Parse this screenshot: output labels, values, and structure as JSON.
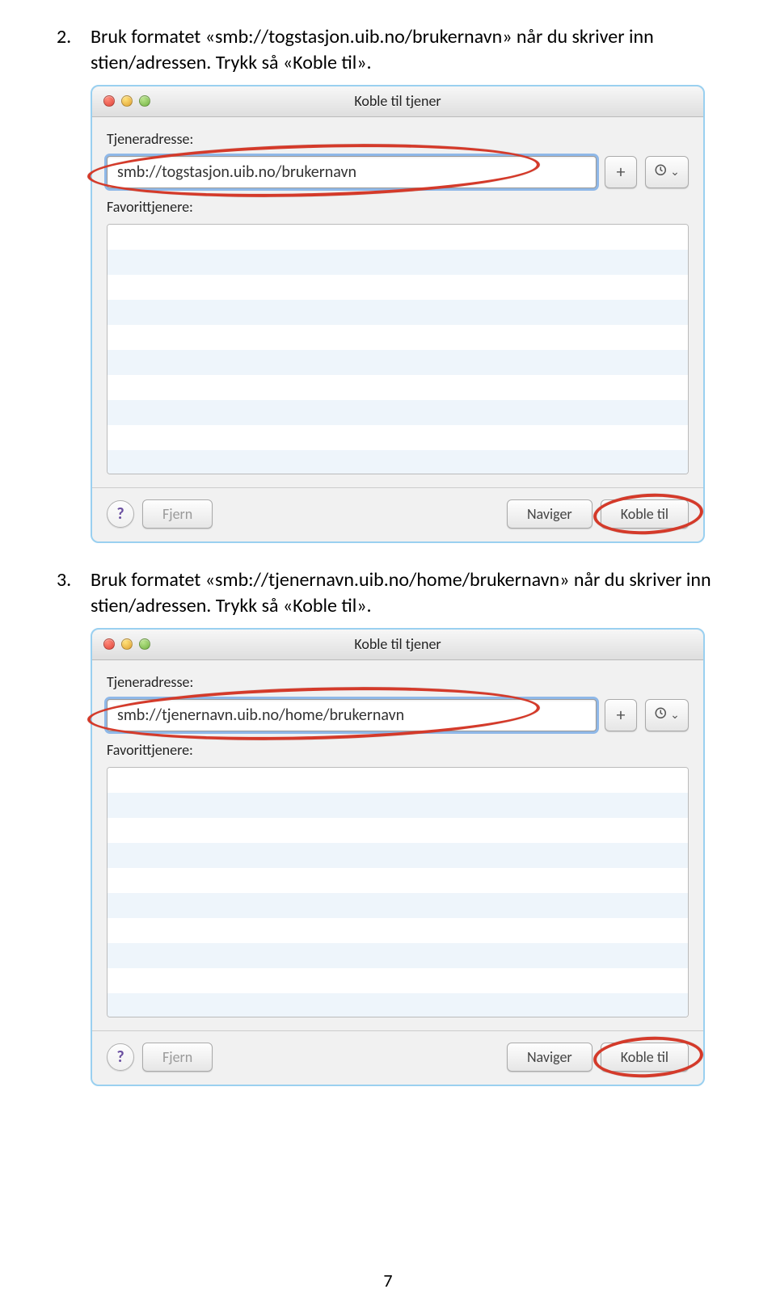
{
  "step2": {
    "num": "2.",
    "text": "Bruk formatet «smb://togstasjon.uib.no/brukernavn» når du skriver inn stien/adressen. Trykk så «Koble til»."
  },
  "step3": {
    "num": "3.",
    "text": "Bruk formatet «smb://tjenernavn.uib.no/home/brukernavn» når du skriver inn stien/adressen. Trykk så «Koble til»."
  },
  "dialog1": {
    "title": "Koble til tjener",
    "addressLabel": "Tjeneradresse:",
    "addressValue": "smb://togstasjon.uib.no/brukernavn",
    "favLabel": "Favorittjenere:",
    "addBtn": "+",
    "historyBtn": "⌄",
    "helpBtn": "?",
    "removeBtn": "Fjern",
    "browseBtn": "Naviger",
    "connectBtn": "Koble til"
  },
  "dialog2": {
    "title": "Koble til tjener",
    "addressLabel": "Tjeneradresse:",
    "addressValue": "smb://tjenernavn.uib.no/home/brukernavn",
    "favLabel": "Favorittjenere:",
    "addBtn": "+",
    "historyBtn": "⌄",
    "helpBtn": "?",
    "removeBtn": "Fjern",
    "browseBtn": "Naviger",
    "connectBtn": "Koble til"
  },
  "pageNumber": "7"
}
